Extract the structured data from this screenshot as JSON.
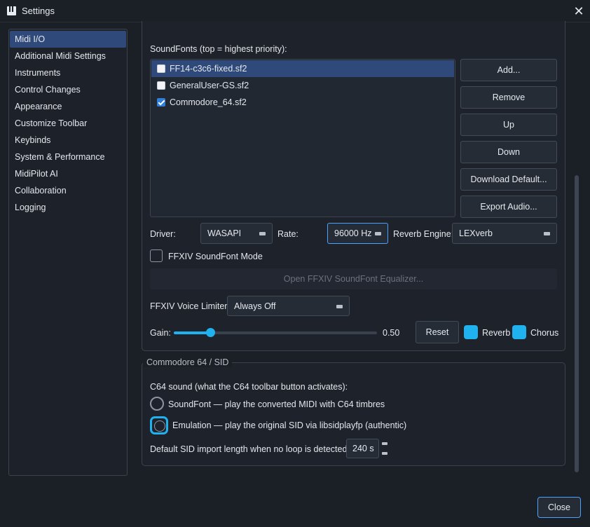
{
  "window": {
    "title": "Settings",
    "app_icon": "piano-keys-icon",
    "close_icon": "close-icon"
  },
  "sidebar": {
    "items": [
      {
        "label": "Midi I/O",
        "active": true
      },
      {
        "label": "Additional Midi Settings"
      },
      {
        "label": "Instruments"
      },
      {
        "label": "Control Changes"
      },
      {
        "label": "Appearance"
      },
      {
        "label": "Customize Toolbar"
      },
      {
        "label": "Keybinds"
      },
      {
        "label": "System & Performance"
      },
      {
        "label": "MidiPilot AI"
      },
      {
        "label": "Collaboration"
      },
      {
        "label": "Logging"
      }
    ]
  },
  "soundfonts": {
    "heading": "SoundFonts (top = highest priority):",
    "list": [
      {
        "name": "FF14-c3c6-fixed.sf2",
        "checked": false,
        "selected": true
      },
      {
        "name": "GeneralUser-GS.sf2",
        "checked": false
      },
      {
        "name": "Commodore_64.sf2",
        "checked": true
      }
    ],
    "buttons": {
      "add": "Add...",
      "remove": "Remove",
      "up": "Up",
      "down": "Down",
      "download_default": "Download Default...",
      "export_audio": "Export Audio..."
    },
    "driver_label": "Driver:",
    "driver_value": "WASAPI",
    "rate_label": "Rate:",
    "rate_value": "96000 Hz",
    "reverb_engine_label": "Reverb Engine:",
    "reverb_engine_value": "LEXverb",
    "ffxiv_mode_label": "FFXIV SoundFont Mode",
    "ffxiv_equalizer_button": "Open FFXIV SoundFont Equalizer...",
    "voice_limiter_label": "FFXIV Voice Limiter:",
    "voice_limiter_value": "Always Off",
    "gain_label": "Gain:",
    "gain_value": "0.50",
    "gain_fraction": 0.18,
    "reset_button": "Reset",
    "reverb_label": "Reverb",
    "chorus_label": "Chorus",
    "accent_color": "#1fb2ee"
  },
  "c64": {
    "group_title": "Commodore 64 / SID",
    "sound_heading": "C64 sound (what the C64 toolbar button activates):",
    "option_soundfont": "SoundFont — play the converted MIDI with C64 timbres",
    "option_emulation": "Emulation — play the original SID via libsidplayfp (authentic)",
    "length_label": "Default SID import length when no loop is detected:",
    "length_value": "240 s"
  },
  "footer": {
    "close_button": "Close"
  }
}
